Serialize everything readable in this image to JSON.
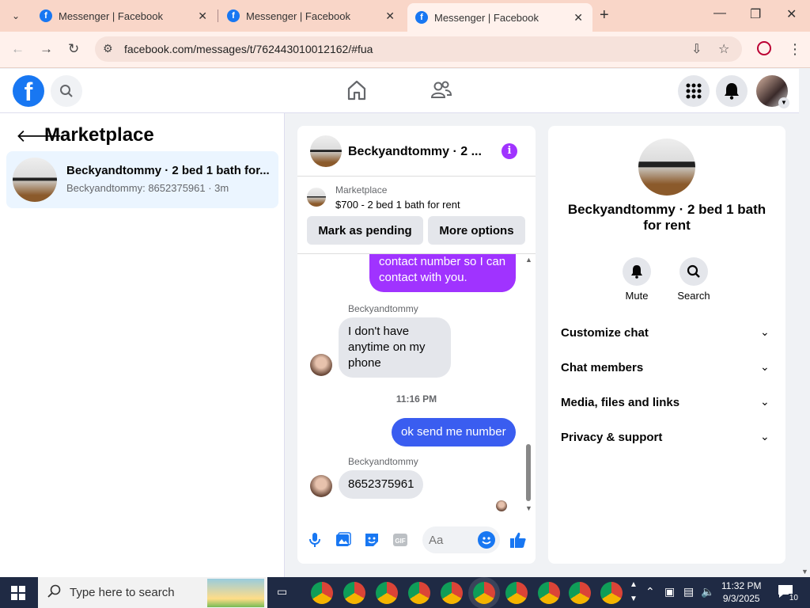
{
  "browser": {
    "tabs": [
      {
        "title": "Messenger | Facebook"
      },
      {
        "title": "Messenger | Facebook"
      },
      {
        "title": "Messenger | Facebook"
      }
    ],
    "url": "facebook.com/messages/t/762443010012162/#fua"
  },
  "sidebar": {
    "title": "Marketplace",
    "conversation": {
      "name": "Beckyandtommy · 2 bed 1 bath for...",
      "preview": "Beckyandtommy: 8652375961 · 3m"
    }
  },
  "chat": {
    "header_title": "Beckyandtommy · 2 ...",
    "marketplace_label": "Marketplace",
    "listing": "$700 - 2 bed 1 bath for rent",
    "buttons": {
      "pending": "Mark as pending",
      "more": "More options"
    },
    "messages": {
      "m1": "contact number so I can contact with you.",
      "sender1": "Beckyandtommy",
      "m2": "I don't have anytime on my phone",
      "time": "11:16 PM",
      "m3": "ok send me number",
      "sender2": "Beckyandtommy",
      "m4": "8652375961"
    },
    "composer_placeholder": "Aa"
  },
  "info": {
    "title": "Beckyandtommy · 2 bed 1 bath for rent",
    "mute": "Mute",
    "search": "Search",
    "sections": [
      "Customize chat",
      "Chat members",
      "Media, files and links",
      "Privacy & support"
    ]
  },
  "taskbar": {
    "search_placeholder": "Type here to search",
    "time": "11:32 PM",
    "date": "9/3/2025",
    "notifications": "10"
  },
  "colors": {
    "fb_blue": "#1877f2",
    "purple": "#a033ff",
    "bubble_blue": "#3a5df0"
  }
}
